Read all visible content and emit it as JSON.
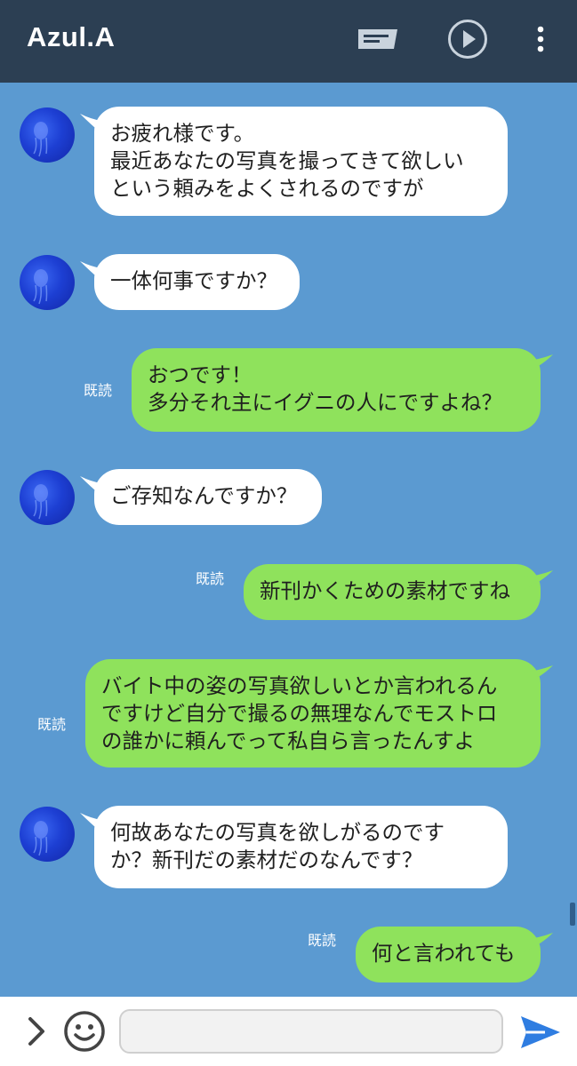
{
  "header": {
    "title": "Azul.A",
    "icons": [
      "notes-icon",
      "play-icon",
      "more-vertical-icon"
    ]
  },
  "messages": [
    {
      "side": "in",
      "lines": [
        "お疲れ様です。",
        "最近あなたの写真を撮ってきて欲しい",
        "という頼みをよくされるのですが"
      ]
    },
    {
      "side": "in",
      "lines": [
        "一体何事ですか？"
      ]
    },
    {
      "side": "out",
      "read": "既読",
      "lines": [
        "おつです！",
        "多分それ主にイグニの人にですよね？"
      ]
    },
    {
      "side": "in",
      "lines": [
        "ご存知なんですか？"
      ]
    },
    {
      "side": "out",
      "read": "既読",
      "lines": [
        "新刊かくための素材ですね"
      ]
    },
    {
      "side": "out",
      "read": "既読",
      "lines": [
        "バイト中の姿の写真欲しいとか言われるん",
        "ですけど自分で撮るの無理なんでモストロ",
        "の誰かに頼んでって私自ら言ったんすよ"
      ]
    },
    {
      "side": "in",
      "lines": [
        "何故あなたの写真を欲しがるのです",
        "か？新刊だの素材だのなんです？"
      ]
    },
    {
      "side": "out",
      "read": "既読",
      "lines": [
        "何と言われても"
      ]
    }
  ],
  "input_bar": {
    "placeholder": "",
    "icons": [
      "chevron-right-icon",
      "emoji-icon",
      "send-icon"
    ]
  },
  "colors": {
    "header_bg": "#2c3f53",
    "chat_bg": "#5b9ad1",
    "incoming_bubble": "#ffffff",
    "outgoing_bubble": "#8fe25c",
    "send_icon": "#2f7de1"
  }
}
